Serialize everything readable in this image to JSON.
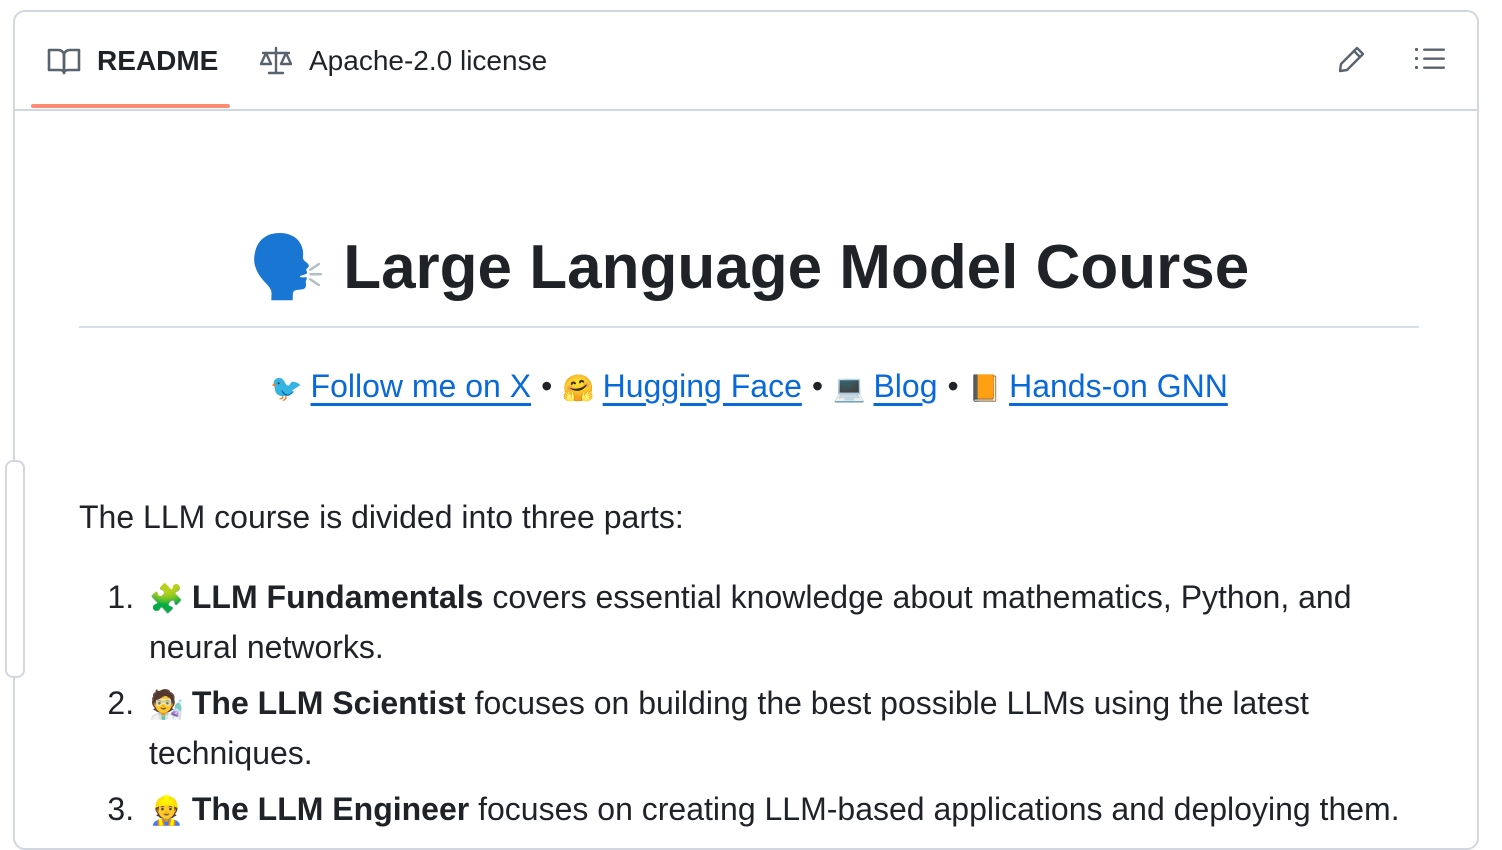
{
  "tabs": {
    "readme_label": "README",
    "license_label": "Apache-2.0 license"
  },
  "icons": {
    "readme": "book-icon",
    "license": "scale-balance-icon",
    "edit": "pencil-icon",
    "toc": "list-icon"
  },
  "accent_color": "#fd8c73",
  "link_color": "#0969da",
  "readme": {
    "title_emoji": "🗣️",
    "title": "Large Language Model Course",
    "links": [
      {
        "emoji": "🐦",
        "label": "Follow me on X"
      },
      {
        "emoji": "🤗",
        "label": "Hugging Face"
      },
      {
        "emoji": "💻",
        "label": "Blog"
      },
      {
        "emoji": "📙",
        "label": "Hands-on GNN"
      }
    ],
    "separator": "•",
    "intro": "The LLM course is divided into three parts:",
    "parts": [
      {
        "emoji": "🧩",
        "bold": "LLM Fundamentals",
        "text": " covers essential knowledge about mathematics, Python, and neural networks."
      },
      {
        "emoji": "🧑‍🔬",
        "bold": "The LLM Scientist",
        "text": " focuses on building the best possible LLMs using the latest techniques."
      },
      {
        "emoji": "👷",
        "bold": "The LLM Engineer",
        "text": " focuses on creating LLM-based applications and deploying them."
      }
    ]
  }
}
